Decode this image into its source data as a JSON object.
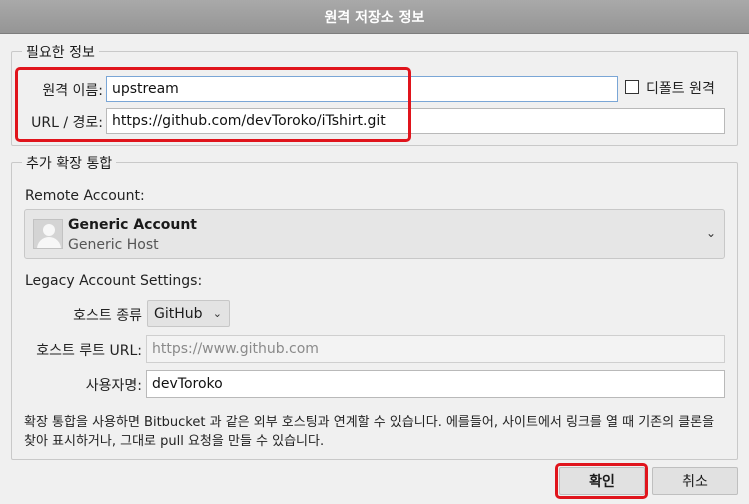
{
  "dialog": {
    "title": "원격 저장소 정보"
  },
  "required": {
    "legend": "필요한 정보",
    "remote_name_label": "원격 이름:",
    "remote_name_value": "upstream",
    "default_remote_label": "디폴트 원격",
    "default_remote_checked": false,
    "url_label": "URL / 경로:",
    "url_value": "https://github.com/devToroko/iTshirt.git"
  },
  "integration": {
    "legend": "추가 확장 통합",
    "remote_account_label": "Remote Account:",
    "account": {
      "name": "Generic Account",
      "host": "Generic Host"
    },
    "legacy_label": "Legacy Account Settings:",
    "host_type_label": "호스트 종류",
    "host_type_value": "GitHub",
    "host_root_label": "호스트 루트 URL:",
    "host_root_value": "https://www.github.com",
    "username_label": "사용자명:",
    "username_value": "devToroko",
    "description": "확장 통합을 사용하면 Bitbucket 과 같은 외부 호스팅과 연계할 수 있습니다. 에를들어, 사이트에서 링크를 열 때 기존의 클론을 찾아 표시하거나, 그대로 pull 요청을 만들 수 있습니다."
  },
  "buttons": {
    "ok": "확인",
    "cancel": "취소"
  },
  "colors": {
    "highlight": "#e0141c",
    "titlebar": "#a0a0a0"
  }
}
